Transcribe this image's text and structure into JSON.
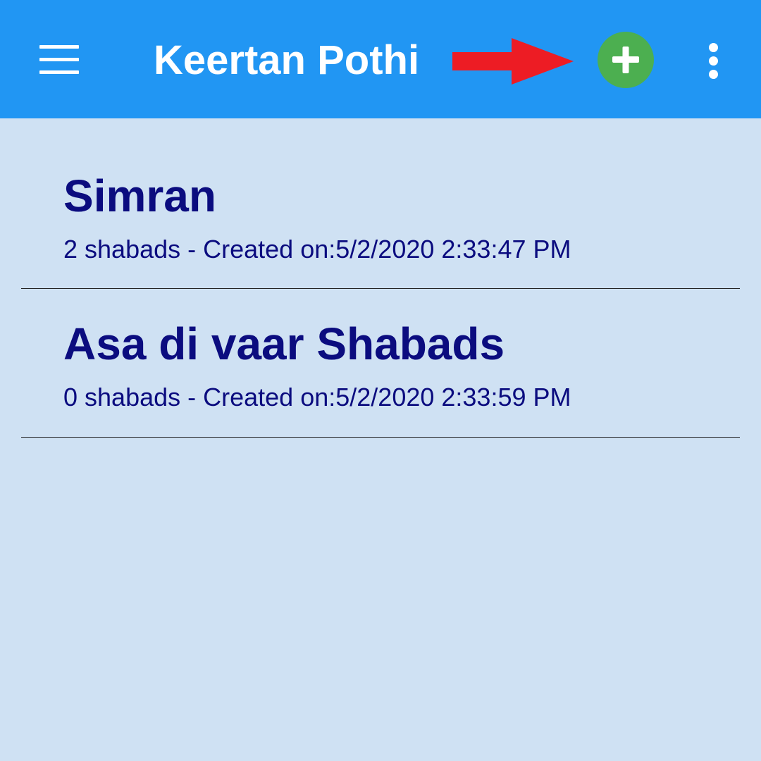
{
  "appbar": {
    "title": "Keertan Pothi",
    "color": "#2196f3",
    "menu_icon": "hamburger-menu-icon",
    "add_icon": "plus-icon",
    "add_color": "#4caf50",
    "overflow_icon": "vertical-dots-icon"
  },
  "annotation": {
    "arrow_icon": "red-arrow-right-icon",
    "color": "#ed1c24"
  },
  "pothis": [
    {
      "name": "Simran",
      "meta": "2 shabads - Created on:5/2/2020 2:33:47 PM"
    },
    {
      "name": "Asa di vaar Shabads",
      "meta": "0 shabads - Created on:5/2/2020 2:33:59 PM"
    }
  ],
  "colors": {
    "background": "#cfe1f3",
    "list_text": "#0b0c7f"
  }
}
